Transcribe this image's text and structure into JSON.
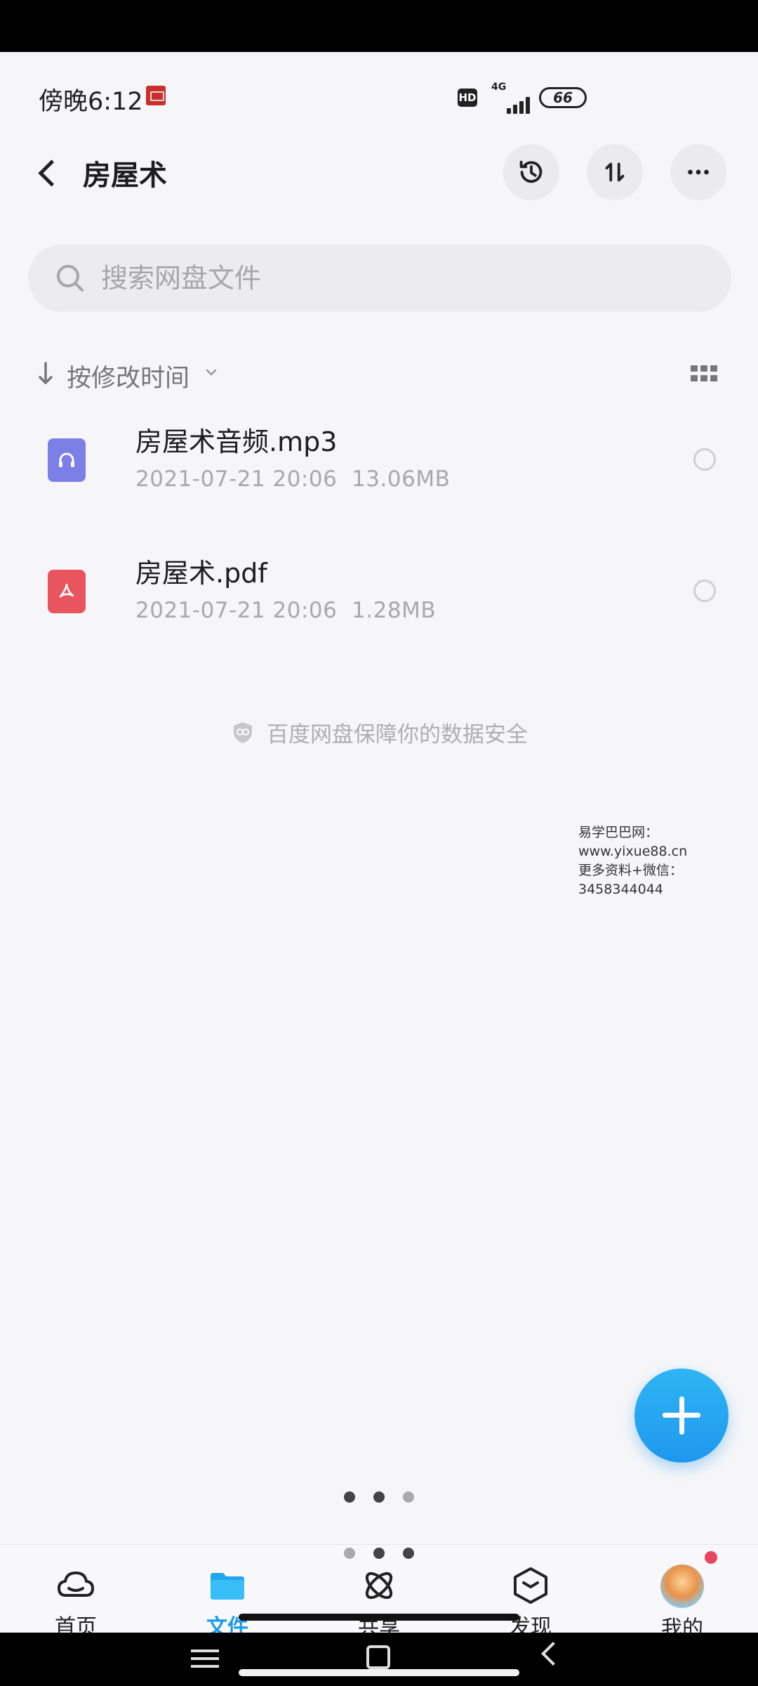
{
  "status": {
    "time": "傍晚6:12",
    "hd": "HD",
    "network": "4G",
    "battery": "66"
  },
  "header": {
    "title": "房屋术"
  },
  "search": {
    "placeholder": "搜索网盘文件"
  },
  "sort": {
    "label": "按修改时间"
  },
  "files": [
    {
      "name": "房屋术音频.mp3",
      "date": "2021-07-21  20:06",
      "size": "13.06MB",
      "icon": "audio-file-icon",
      "color": "#7b7fe6"
    },
    {
      "name": "房屋术.pdf",
      "date": "2021-07-21  20:06",
      "size": "1.28MB",
      "icon": "pdf-file-icon",
      "color": "#e8555f"
    }
  ],
  "security": {
    "text": "百度网盘保障你的数据安全"
  },
  "watermark": {
    "line1": "易学巴巴网：www.yixue88.cn",
    "line2": "更多资料+微信：3458344044"
  },
  "nav": {
    "items": [
      {
        "label": "首页",
        "icon": "cloud-icon"
      },
      {
        "label": "文件",
        "icon": "folder-icon",
        "active": true
      },
      {
        "label": "共享",
        "icon": "share-icon"
      },
      {
        "label": "发现",
        "icon": "discover-icon"
      },
      {
        "label": "我的",
        "icon": "avatar"
      }
    ]
  },
  "colors": {
    "accent": "#1e9ae8",
    "background": "#f6f6f8"
  }
}
